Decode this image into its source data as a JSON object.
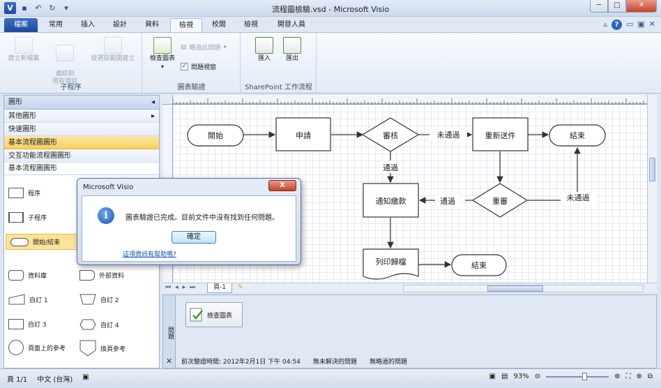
{
  "titlebar": {
    "title": "流程圖檢驗.vsd  -  Microsoft Visio",
    "app_icon": "V",
    "min": "─",
    "max": "□",
    "close": "✕"
  },
  "tabs": [
    "檔案",
    "常用",
    "插入",
    "設計",
    "資料",
    "檢視",
    "校閱",
    "檢視",
    "開發人員"
  ],
  "ribbon": {
    "group_subprocess": {
      "label": "子程序",
      "new": "建立新檔案",
      "link": "連結到\n現有項目",
      "from_selection": "從選取範圍建立"
    },
    "group_validation": {
      "label": "圖表驗證",
      "check": "檢查圖表",
      "ignore": "略過此問題",
      "issues_window": "問題視窗"
    },
    "group_sharepoint": {
      "label": "SharePoint 工作流程",
      "import": "匯入",
      "export": "匯出"
    }
  },
  "shapes_pane": {
    "header": "圖形",
    "more": "其他圖形",
    "quick": "快速圖形",
    "basic": "基本流程圖圖形",
    "cross": "交互功能流程圖圖形",
    "stencil_title": "基本流程圖圖形",
    "items": {
      "process": "程序",
      "subprocess": "子程序",
      "start_end": "開始/結束",
      "database": "資料庫",
      "external_data": "外部資料",
      "custom1": "自訂 1",
      "custom2": "自訂 2",
      "custom3": "自訂 3",
      "custom4": "自訂 4",
      "on_page_ref": "頁面上的參考",
      "off_page_ref": "換頁參考"
    }
  },
  "flowchart": {
    "start": "開始",
    "apply": "申請",
    "review": "審核",
    "not_passed": "未通過",
    "resubmit": "重新送件",
    "end1": "結束",
    "passed": "通過",
    "notify": "通知繳款",
    "passed2": "通過",
    "re_review": "重審",
    "not_passed2": "未通過",
    "print": "列印歸檔",
    "end2": "結束"
  },
  "pagebar": {
    "page_tab": "頁-1"
  },
  "issues": {
    "vertical_label": "問題",
    "check_button": "檢查圖表",
    "last_validated": "前次驗證時間: 2012年2月1日 下午 04:54",
    "unresolved": "無未解決的問題",
    "ignored": "無略過的問題"
  },
  "statusbar": {
    "page": "頁 1/1",
    "language": "中文 (台灣)",
    "zoom": "93%"
  },
  "dialog": {
    "title": "Microsoft Visio",
    "close": "X",
    "message": "圖表驗證已完成。目前文件中沒有找到任何問題。",
    "ok": "確定",
    "help_link": "這項資訊有幫助嗎?"
  }
}
